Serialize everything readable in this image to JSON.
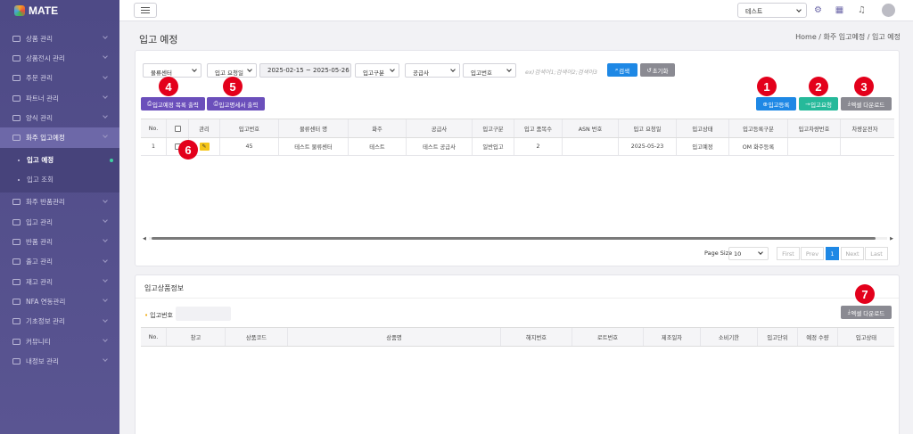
{
  "app": {
    "logo": "MATE"
  },
  "sidebar": {
    "items": [
      {
        "label": "상품 관리"
      },
      {
        "label": "상품전시 관리"
      },
      {
        "label": "주문 관리"
      },
      {
        "label": "파트너 관리"
      },
      {
        "label": "양식 관리"
      },
      {
        "label": "화주 입고예정"
      }
    ],
    "sub": [
      {
        "label": "입고 예정"
      },
      {
        "label": "입고 조회"
      }
    ],
    "items2": [
      {
        "label": "화주 반품관리"
      },
      {
        "label": "입고 관리"
      },
      {
        "label": "반품 관리"
      },
      {
        "label": "출고 관리"
      },
      {
        "label": "재고 관리"
      },
      {
        "label": "NFA 연동관리"
      },
      {
        "label": "기초정보 관리"
      },
      {
        "label": "커뮤니티"
      },
      {
        "label": "내정보 관리"
      }
    ]
  },
  "topbar": {
    "select": "테스트"
  },
  "page": {
    "title": "입고 예정",
    "breadcrumb": "Home / 화주 입고예정 / 입고 예정"
  },
  "filters": {
    "center": "물류센터",
    "date_type": "입고 요청일",
    "date_range": "2025-02-15 ~ 2025-05-26",
    "in_type": "입고구분",
    "supplier": "공급사",
    "in_no": "입고번호",
    "placeholder": "ex)검색어1;검색어2;검색어3",
    "search": "검색",
    "reset": "초기화"
  },
  "buttons": {
    "print_list": "입고예정 목록 출력",
    "print_detail": "입고명세서 출력",
    "register": "입고등록",
    "request": "입고요청",
    "excel": "엑셀 다운로드",
    "excel2": "엑셀 다운로드"
  },
  "badges": [
    "1",
    "2",
    "3",
    "4",
    "5",
    "6",
    "7"
  ],
  "table": {
    "headers": [
      "No.",
      "",
      "관리",
      "입고번호",
      "물류센터 명",
      "화주",
      "공급사",
      "입고구분",
      "입고 품목수",
      "ASN 번호",
      "입고 요청일",
      "입고상태",
      "입고등록구분",
      "입고차량번호",
      "차량운전자"
    ],
    "rows": [
      [
        "1",
        "",
        "",
        "45",
        "테스트 물류센터",
        "테스트",
        "테스트 공급사",
        "일반입고",
        "2",
        "",
        "2025-05-23",
        "입고예정",
        "OM 화주등록",
        "",
        ""
      ]
    ]
  },
  "pager": {
    "label": "Page Size",
    "size": "10",
    "first": "First",
    "prev": "Prev",
    "page": "1",
    "next": "Next",
    "last": "Last"
  },
  "detail": {
    "title": "입고상품정보",
    "in_no_label": "입고번호",
    "headers": [
      "No.",
      "창고",
      "상품코드",
      "상품명",
      "해지번호",
      "로트번호",
      "제조일자",
      "소비기한",
      "입고단위",
      "예정 수량",
      "입고상태"
    ]
  },
  "colors": {
    "sidebar": "#4e4a86",
    "primary": "#1e88e5",
    "green": "#26b99a",
    "purple": "#6b4fbb",
    "badge": "#e3001b"
  }
}
